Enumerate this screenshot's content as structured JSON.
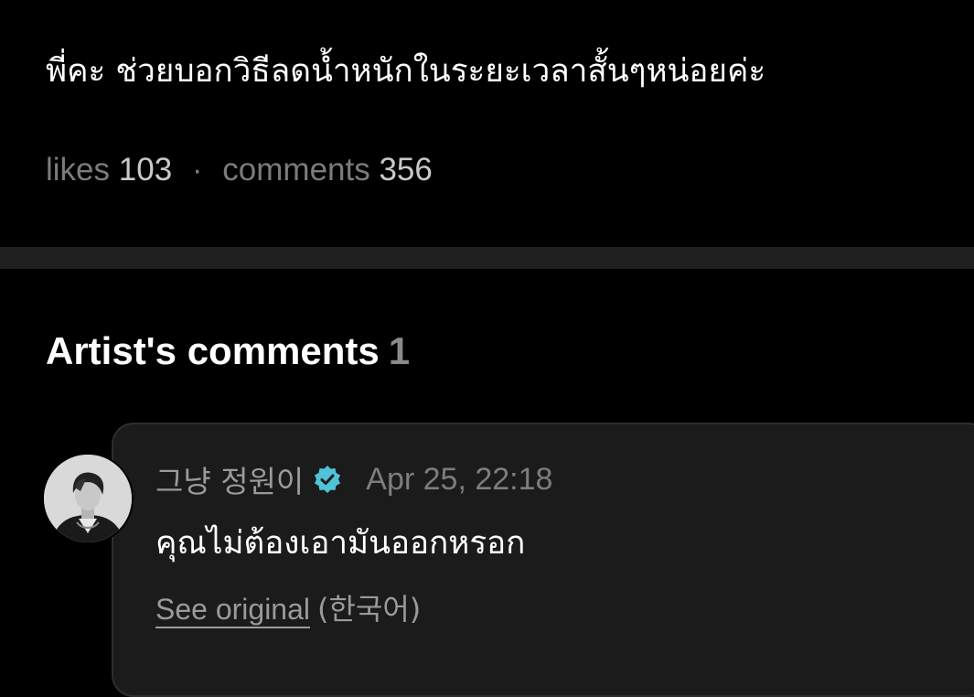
{
  "post": {
    "text": "พี่คะ ช่วยบอกวิธีลดน้ำหนักในระยะเวลาสั้นๆหน่อยค่ะ",
    "likes_label": "likes",
    "likes_count": "103",
    "separator": "·",
    "comments_label": "comments",
    "comments_count": "356"
  },
  "artist_comments": {
    "title": "Artist's comments",
    "count": "1",
    "items": [
      {
        "author": "그냥 정원이",
        "verified_icon": "verified-badge-icon",
        "timestamp": "Apr 25, 22:18",
        "text": "คุณไม่ต้องเอามันออกหรอก",
        "see_original_label": "See original",
        "original_language": "(한국어)"
      }
    ]
  },
  "colors": {
    "background": "#000000",
    "divider": "#1f1f1f",
    "card": "#1b1b1b",
    "verified": "#4fc3d9",
    "muted_text": "#9a9a9a"
  }
}
